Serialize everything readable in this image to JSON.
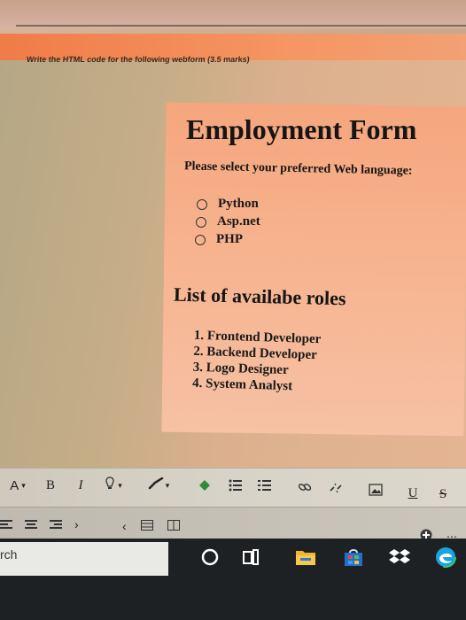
{
  "question": "Write the HTML code for the following webform (3.5 marks)",
  "form": {
    "title": "Employment Form",
    "prompt": "Please select your preferred Web language:",
    "languages": [
      "Python",
      "Asp.net",
      "PHP"
    ]
  },
  "roles": {
    "heading": "List of availabe roles",
    "items": [
      "1. Frontend Developer",
      "2. Backend Developer",
      "3. Logo Designer",
      "4. System Analyst"
    ]
  },
  "toolbar": {
    "font_color": "A",
    "bold": "B",
    "italic": "I",
    "underline": "U",
    "strikethrough": "S"
  },
  "taskbar": {
    "search_text": "rch"
  },
  "colors": {
    "form_background": "#f6b08c",
    "taskbar": "#1e2123",
    "toolbar": "#d6d1c6"
  },
  "icons": [
    "font-color-icon",
    "highlight-icon",
    "brush-icon",
    "bulleted-list-icon",
    "numbered-list-icon",
    "link-icon",
    "unlink-icon",
    "image-icon",
    "task-view-icon",
    "file-explorer-icon",
    "store-icon",
    "dropbox-icon",
    "edge-icon",
    "cortana-icon"
  ]
}
